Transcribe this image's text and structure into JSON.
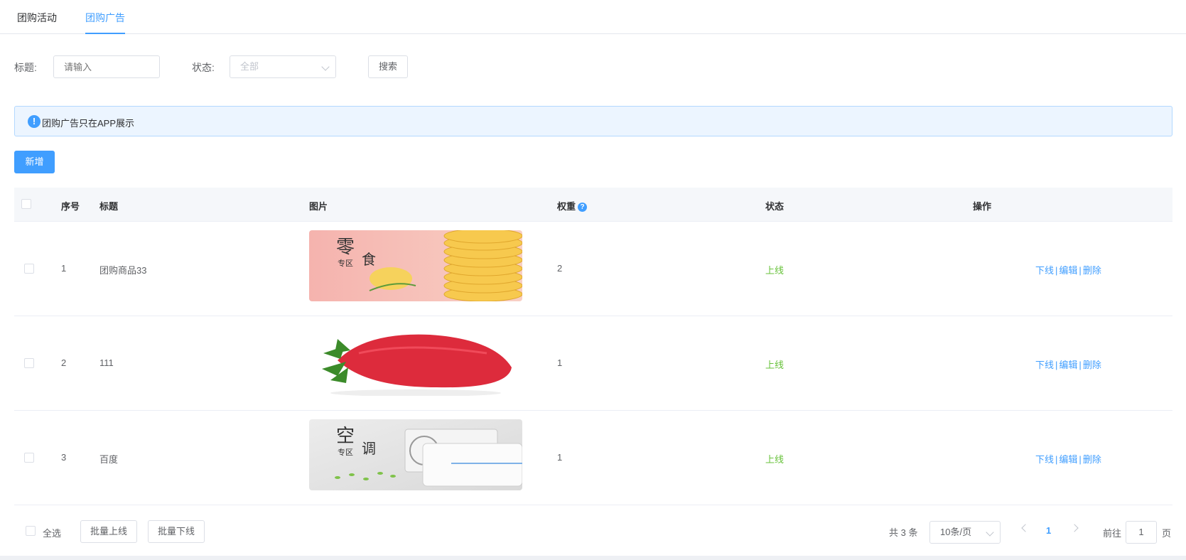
{
  "tabs": [
    {
      "label": "团购活动",
      "active": false
    },
    {
      "label": "团购广告",
      "active": true
    }
  ],
  "filters": {
    "title_label": "标题:",
    "title_placeholder": "请输入",
    "status_label": "状态:",
    "status_value": "全部",
    "search_label": "搜索"
  },
  "alert": {
    "text": "团购广告只在APP展示"
  },
  "toolbar": {
    "add_label": "新增"
  },
  "table": {
    "headers": {
      "index": "序号",
      "title": "标题",
      "image": "图片",
      "weight": "权重",
      "status": "状态",
      "ops": "操作"
    },
    "rows": [
      {
        "index": "1",
        "title": "团购商品33",
        "image_big": "零",
        "image_small": "专区",
        "image_big2": "食",
        "weight": "2",
        "status": "上线",
        "op1": "下线",
        "op2": "编辑",
        "op3": "删除"
      },
      {
        "index": "2",
        "title": "111",
        "weight": "1",
        "status": "上线",
        "op1": "下线",
        "op2": "编辑",
        "op3": "删除"
      },
      {
        "index": "3",
        "title": "百度",
        "image_big": "空",
        "image_small": "专区",
        "image_big2": "调",
        "weight": "1",
        "status": "上线",
        "op1": "下线",
        "op2": "编辑",
        "op3": "删除"
      }
    ]
  },
  "footer": {
    "select_all": "全选",
    "batch_online": "批量上线",
    "batch_offline": "批量下线",
    "total": "共 3 条",
    "page_size": "10条/页",
    "current_page": "1",
    "goto_label": "前往",
    "goto_value": "1",
    "page_unit": "页"
  },
  "colors": {
    "primary": "#409eff",
    "success": "#67c23a"
  }
}
